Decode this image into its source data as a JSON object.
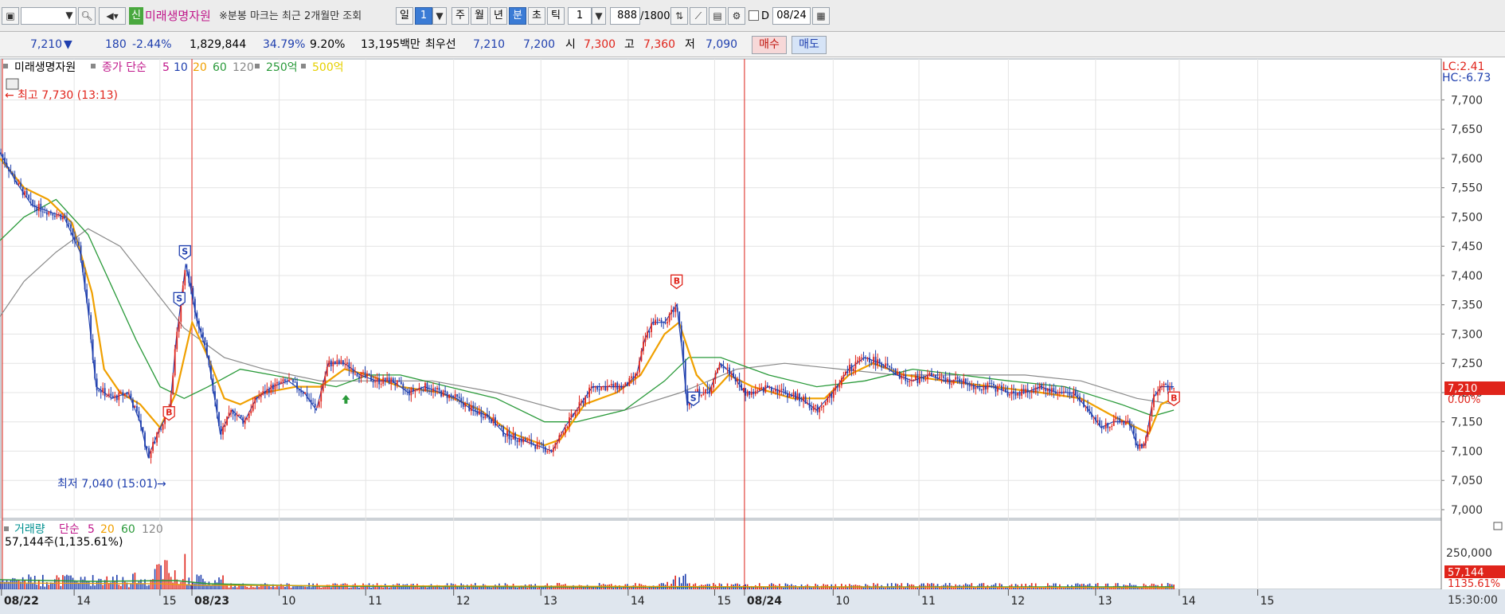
{
  "toolbar": {
    "stock_name": "미래생명자원",
    "stock_badge": "신",
    "notice": "※분봉 마크는 최근 2개월만 조회",
    "period_day": "일",
    "period_value": "1",
    "week": "주",
    "month": "월",
    "year": "년",
    "minute": "분",
    "second": "초",
    "tick": "틱",
    "interval": "1",
    "count": "888",
    "count_total": "/1800",
    "d_label": "D",
    "date": "08/24"
  },
  "quote": {
    "price": "7,210",
    "arrow": "▼",
    "change": "180",
    "change_pct": "-2.44%",
    "volume": "1,829,844",
    "ratio1": "34.79%",
    "ratio2": "9.20%",
    "amount": "13,195백만",
    "best_label": "최우선",
    "best_ask": "7,210",
    "best_bid": "7,200",
    "open_label": "시",
    "open": "7,300",
    "high_label": "고",
    "high": "7,360",
    "low_label": "저",
    "low": "7,090",
    "buy_button": "매수",
    "sell_button": "매도"
  },
  "colors": {
    "up": "#e0241b",
    "down": "#1f3fae",
    "ma5": "#1f3fae",
    "ma10": "#1f3fae",
    "ma20": "#f0a000",
    "ma60": "#2a9a3a",
    "ma120": "#8a8a8a"
  },
  "chart_data": {
    "type": "candlestick",
    "price_legend": {
      "name": "미래생명자원",
      "close_label": "종가 단순",
      "ma_periods": [
        "5",
        "10",
        "20",
        "60",
        "120"
      ],
      "extra": [
        "250억",
        "500억"
      ]
    },
    "volume_legend": {
      "name": "거래량",
      "label": "단순",
      "ma_periods": [
        "5",
        "20",
        "60",
        "120"
      ],
      "value": "57,144주(1,135.61%)"
    },
    "lc": "LC:2.41",
    "hc": "HC:-6.73",
    "high_annotation": "최고 7,730 (13:13)",
    "low_annotation": "최저 7,040 (15:01)",
    "current_price": "7,210",
    "current_pct": "0.00%",
    "current_volume": "57,144",
    "current_volume_pct": "1135.61%",
    "y_ticks": [
      "7,700",
      "7,650",
      "7,600",
      "7,550",
      "7,500",
      "7,450",
      "7,400",
      "7,350",
      "7,300",
      "7,250",
      "7,200",
      "7,150",
      "7,100",
      "7,050",
      "7,000"
    ],
    "y_range": [
      6985,
      7770
    ],
    "volume_tick": "250,000",
    "x_labels": [
      "08/22",
      "14",
      "15",
      "08/23",
      "10",
      "11",
      "12",
      "13",
      "14",
      "15",
      "08/24",
      "10",
      "11",
      "12",
      "13",
      "14",
      "15"
    ],
    "time_label": "15:30:00",
    "markers": [
      {
        "type": "B",
        "x": 211,
        "y": 7165
      },
      {
        "type": "S",
        "x": 224,
        "y": 7360
      },
      {
        "type": "S",
        "x": 231,
        "y": 7440
      },
      {
        "type": "B",
        "x": 845,
        "y": 7390
      },
      {
        "type": "S",
        "x": 866,
        "y": 7190
      },
      {
        "type": "B",
        "x": 1466,
        "y": 7190
      }
    ],
    "close": [
      {
        "x": 0,
        "y": 7610
      },
      {
        "x": 20,
        "y": 7560
      },
      {
        "x": 40,
        "y": 7520
      },
      {
        "x": 60,
        "y": 7510
      },
      {
        "x": 80,
        "y": 7500
      },
      {
        "x": 100,
        "y": 7440
      },
      {
        "x": 110,
        "y": 7340
      },
      {
        "x": 120,
        "y": 7210
      },
      {
        "x": 140,
        "y": 7190
      },
      {
        "x": 160,
        "y": 7200
      },
      {
        "x": 175,
        "y": 7150
      },
      {
        "x": 185,
        "y": 7090
      },
      {
        "x": 200,
        "y": 7140
      },
      {
        "x": 212,
        "y": 7170
      },
      {
        "x": 220,
        "y": 7290
      },
      {
        "x": 232,
        "y": 7420
      },
      {
        "x": 245,
        "y": 7330
      },
      {
        "x": 260,
        "y": 7260
      },
      {
        "x": 275,
        "y": 7130
      },
      {
        "x": 290,
        "y": 7170
      },
      {
        "x": 305,
        "y": 7150
      },
      {
        "x": 320,
        "y": 7190
      },
      {
        "x": 340,
        "y": 7210
      },
      {
        "x": 360,
        "y": 7220
      },
      {
        "x": 380,
        "y": 7200
      },
      {
        "x": 395,
        "y": 7170
      },
      {
        "x": 410,
        "y": 7250
      },
      {
        "x": 430,
        "y": 7250
      },
      {
        "x": 450,
        "y": 7230
      },
      {
        "x": 470,
        "y": 7220
      },
      {
        "x": 490,
        "y": 7220
      },
      {
        "x": 510,
        "y": 7200
      },
      {
        "x": 530,
        "y": 7210
      },
      {
        "x": 550,
        "y": 7200
      },
      {
        "x": 570,
        "y": 7190
      },
      {
        "x": 590,
        "y": 7170
      },
      {
        "x": 610,
        "y": 7160
      },
      {
        "x": 630,
        "y": 7130
      },
      {
        "x": 650,
        "y": 7120
      },
      {
        "x": 670,
        "y": 7110
      },
      {
        "x": 690,
        "y": 7100
      },
      {
        "x": 705,
        "y": 7140
      },
      {
        "x": 720,
        "y": 7170
      },
      {
        "x": 740,
        "y": 7210
      },
      {
        "x": 760,
        "y": 7210
      },
      {
        "x": 780,
        "y": 7210
      },
      {
        "x": 795,
        "y": 7230
      },
      {
        "x": 805,
        "y": 7290
      },
      {
        "x": 815,
        "y": 7320
      },
      {
        "x": 830,
        "y": 7320
      },
      {
        "x": 845,
        "y": 7350
      },
      {
        "x": 852,
        "y": 7270
      },
      {
        "x": 858,
        "y": 7180
      },
      {
        "x": 870,
        "y": 7200
      },
      {
        "x": 885,
        "y": 7200
      },
      {
        "x": 900,
        "y": 7250
      },
      {
        "x": 915,
        "y": 7230
      },
      {
        "x": 930,
        "y": 7200
      },
      {
        "x": 945,
        "y": 7200
      },
      {
        "x": 960,
        "y": 7210
      },
      {
        "x": 980,
        "y": 7200
      },
      {
        "x": 1000,
        "y": 7190
      },
      {
        "x": 1020,
        "y": 7170
      },
      {
        "x": 1040,
        "y": 7200
      },
      {
        "x": 1060,
        "y": 7240
      },
      {
        "x": 1080,
        "y": 7260
      },
      {
        "x": 1100,
        "y": 7250
      },
      {
        "x": 1120,
        "y": 7230
      },
      {
        "x": 1140,
        "y": 7220
      },
      {
        "x": 1160,
        "y": 7230
      },
      {
        "x": 1180,
        "y": 7220
      },
      {
        "x": 1200,
        "y": 7220
      },
      {
        "x": 1220,
        "y": 7210
      },
      {
        "x": 1240,
        "y": 7210
      },
      {
        "x": 1260,
        "y": 7200
      },
      {
        "x": 1280,
        "y": 7200
      },
      {
        "x": 1300,
        "y": 7210
      },
      {
        "x": 1320,
        "y": 7200
      },
      {
        "x": 1340,
        "y": 7200
      },
      {
        "x": 1360,
        "y": 7170
      },
      {
        "x": 1375,
        "y": 7140
      },
      {
        "x": 1390,
        "y": 7150
      },
      {
        "x": 1410,
        "y": 7150
      },
      {
        "x": 1420,
        "y": 7110
      },
      {
        "x": 1430,
        "y": 7110
      },
      {
        "x": 1440,
        "y": 7190
      },
      {
        "x": 1450,
        "y": 7210
      },
      {
        "x": 1466,
        "y": 7210
      }
    ],
    "ma20": [
      {
        "x": 0,
        "y": 7600
      },
      {
        "x": 30,
        "y": 7550
      },
      {
        "x": 60,
        "y": 7530
      },
      {
        "x": 90,
        "y": 7490
      },
      {
        "x": 115,
        "y": 7370
      },
      {
        "x": 130,
        "y": 7240
      },
      {
        "x": 150,
        "y": 7200
      },
      {
        "x": 175,
        "y": 7180
      },
      {
        "x": 200,
        "y": 7140
      },
      {
        "x": 220,
        "y": 7200
      },
      {
        "x": 240,
        "y": 7320
      },
      {
        "x": 260,
        "y": 7260
      },
      {
        "x": 280,
        "y": 7190
      },
      {
        "x": 300,
        "y": 7180
      },
      {
        "x": 330,
        "y": 7200
      },
      {
        "x": 370,
        "y": 7210
      },
      {
        "x": 400,
        "y": 7210
      },
      {
        "x": 430,
        "y": 7240
      },
      {
        "x": 460,
        "y": 7230
      },
      {
        "x": 500,
        "y": 7210
      },
      {
        "x": 550,
        "y": 7200
      },
      {
        "x": 600,
        "y": 7170
      },
      {
        "x": 640,
        "y": 7130
      },
      {
        "x": 680,
        "y": 7110
      },
      {
        "x": 700,
        "y": 7120
      },
      {
        "x": 730,
        "y": 7180
      },
      {
        "x": 770,
        "y": 7200
      },
      {
        "x": 800,
        "y": 7230
      },
      {
        "x": 830,
        "y": 7300
      },
      {
        "x": 848,
        "y": 7320
      },
      {
        "x": 870,
        "y": 7230
      },
      {
        "x": 890,
        "y": 7200
      },
      {
        "x": 910,
        "y": 7230
      },
      {
        "x": 940,
        "y": 7210
      },
      {
        "x": 990,
        "y": 7190
      },
      {
        "x": 1030,
        "y": 7190
      },
      {
        "x": 1060,
        "y": 7230
      },
      {
        "x": 1090,
        "y": 7250
      },
      {
        "x": 1130,
        "y": 7230
      },
      {
        "x": 1180,
        "y": 7220
      },
      {
        "x": 1240,
        "y": 7210
      },
      {
        "x": 1300,
        "y": 7200
      },
      {
        "x": 1350,
        "y": 7190
      },
      {
        "x": 1390,
        "y": 7160
      },
      {
        "x": 1420,
        "y": 7140
      },
      {
        "x": 1435,
        "y": 7130
      },
      {
        "x": 1450,
        "y": 7180
      },
      {
        "x": 1466,
        "y": 7190
      }
    ],
    "ma60": [
      {
        "x": 0,
        "y": 7460
      },
      {
        "x": 30,
        "y": 7500
      },
      {
        "x": 70,
        "y": 7530
      },
      {
        "x": 110,
        "y": 7470
      },
      {
        "x": 140,
        "y": 7380
      },
      {
        "x": 170,
        "y": 7290
      },
      {
        "x": 200,
        "y": 7210
      },
      {
        "x": 230,
        "y": 7190
      },
      {
        "x": 260,
        "y": 7210
      },
      {
        "x": 300,
        "y": 7240
      },
      {
        "x": 340,
        "y": 7230
      },
      {
        "x": 380,
        "y": 7220
      },
      {
        "x": 420,
        "y": 7210
      },
      {
        "x": 460,
        "y": 7230
      },
      {
        "x": 500,
        "y": 7230
      },
      {
        "x": 560,
        "y": 7210
      },
      {
        "x": 620,
        "y": 7190
      },
      {
        "x": 680,
        "y": 7150
      },
      {
        "x": 720,
        "y": 7150
      },
      {
        "x": 780,
        "y": 7170
      },
      {
        "x": 830,
        "y": 7220
      },
      {
        "x": 860,
        "y": 7260
      },
      {
        "x": 900,
        "y": 7260
      },
      {
        "x": 960,
        "y": 7230
      },
      {
        "x": 1020,
        "y": 7210
      },
      {
        "x": 1080,
        "y": 7220
      },
      {
        "x": 1140,
        "y": 7240
      },
      {
        "x": 1200,
        "y": 7230
      },
      {
        "x": 1260,
        "y": 7220
      },
      {
        "x": 1330,
        "y": 7210
      },
      {
        "x": 1400,
        "y": 7180
      },
      {
        "x": 1440,
        "y": 7160
      },
      {
        "x": 1466,
        "y": 7170
      }
    ],
    "ma120": [
      {
        "x": 0,
        "y": 7330
      },
      {
        "x": 30,
        "y": 7390
      },
      {
        "x": 70,
        "y": 7440
      },
      {
        "x": 110,
        "y": 7480
      },
      {
        "x": 150,
        "y": 7450
      },
      {
        "x": 190,
        "y": 7380
      },
      {
        "x": 230,
        "y": 7310
      },
      {
        "x": 280,
        "y": 7260
      },
      {
        "x": 330,
        "y": 7240
      },
      {
        "x": 400,
        "y": 7220
      },
      {
        "x": 460,
        "y": 7220
      },
      {
        "x": 540,
        "y": 7220
      },
      {
        "x": 620,
        "y": 7200
      },
      {
        "x": 700,
        "y": 7170
      },
      {
        "x": 780,
        "y": 7170
      },
      {
        "x": 850,
        "y": 7200
      },
      {
        "x": 920,
        "y": 7240
      },
      {
        "x": 980,
        "y": 7250
      },
      {
        "x": 1050,
        "y": 7240
      },
      {
        "x": 1120,
        "y": 7230
      },
      {
        "x": 1200,
        "y": 7230
      },
      {
        "x": 1280,
        "y": 7230
      },
      {
        "x": 1350,
        "y": 7220
      },
      {
        "x": 1420,
        "y": 7190
      },
      {
        "x": 1466,
        "y": 7180
      }
    ]
  }
}
